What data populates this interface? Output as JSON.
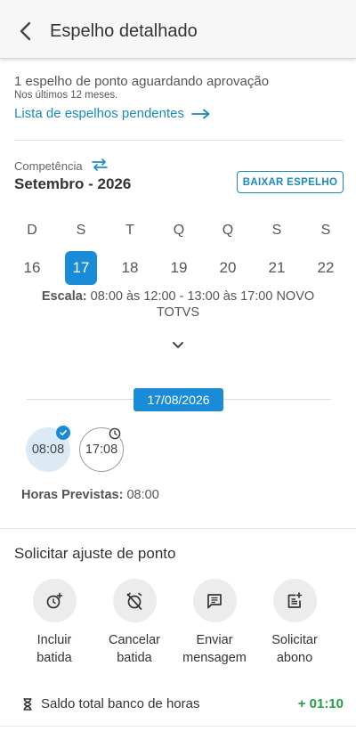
{
  "header": {
    "title": "Espelho detalhado",
    "back_icon": "back-arrow-icon"
  },
  "pending": {
    "message": "1 espelho de ponto aguardando aprovação",
    "subtitle": "Nos últimos 12 meses.",
    "link_label": "Lista de espelhos pendentes"
  },
  "competencia": {
    "label": "Competência",
    "value": "Setembro - 2026",
    "download_label": "BAIXAR ESPELHO"
  },
  "week": {
    "days": [
      {
        "label": "D",
        "num": "16"
      },
      {
        "label": "S",
        "num": "17",
        "selected": true
      },
      {
        "label": "T",
        "num": "18"
      },
      {
        "label": "Q",
        "num": "19"
      },
      {
        "label": "Q",
        "num": "20"
      },
      {
        "label": "S",
        "num": "21"
      },
      {
        "label": "S",
        "num": "22"
      }
    ]
  },
  "escala": {
    "label": "Escala:",
    "value": "08:00 às 12:00 - 13:00 às 17:00  NOVO TOTVS"
  },
  "day": {
    "date": "17/08/2026",
    "punches": [
      {
        "time": "08:08",
        "status": "done"
      },
      {
        "time": "17:08",
        "status": "planned"
      }
    ],
    "horas_label": "Horas Previstas:",
    "horas_value": "08:00"
  },
  "ajuste": {
    "title": "Solicitar ajuste de ponto",
    "actions": [
      {
        "line1": "Incluir",
        "line2": "batida",
        "icon": "add-alarm-icon"
      },
      {
        "line1": "Cancelar",
        "line2": "batida",
        "icon": "alarm-off-icon"
      },
      {
        "line1": "Enviar",
        "line2": "mensagem",
        "icon": "message-icon"
      },
      {
        "line1": "Solicitar",
        "line2": "abono",
        "icon": "post-add-icon"
      }
    ]
  },
  "saldo": {
    "label": "Saldo total banco de horas",
    "value": "+ 01:10",
    "icon": "hourglass-icon"
  },
  "colors": {
    "accent": "#1a8bd6",
    "link": "#1a8bb8",
    "positive": "#1f9e4a"
  }
}
